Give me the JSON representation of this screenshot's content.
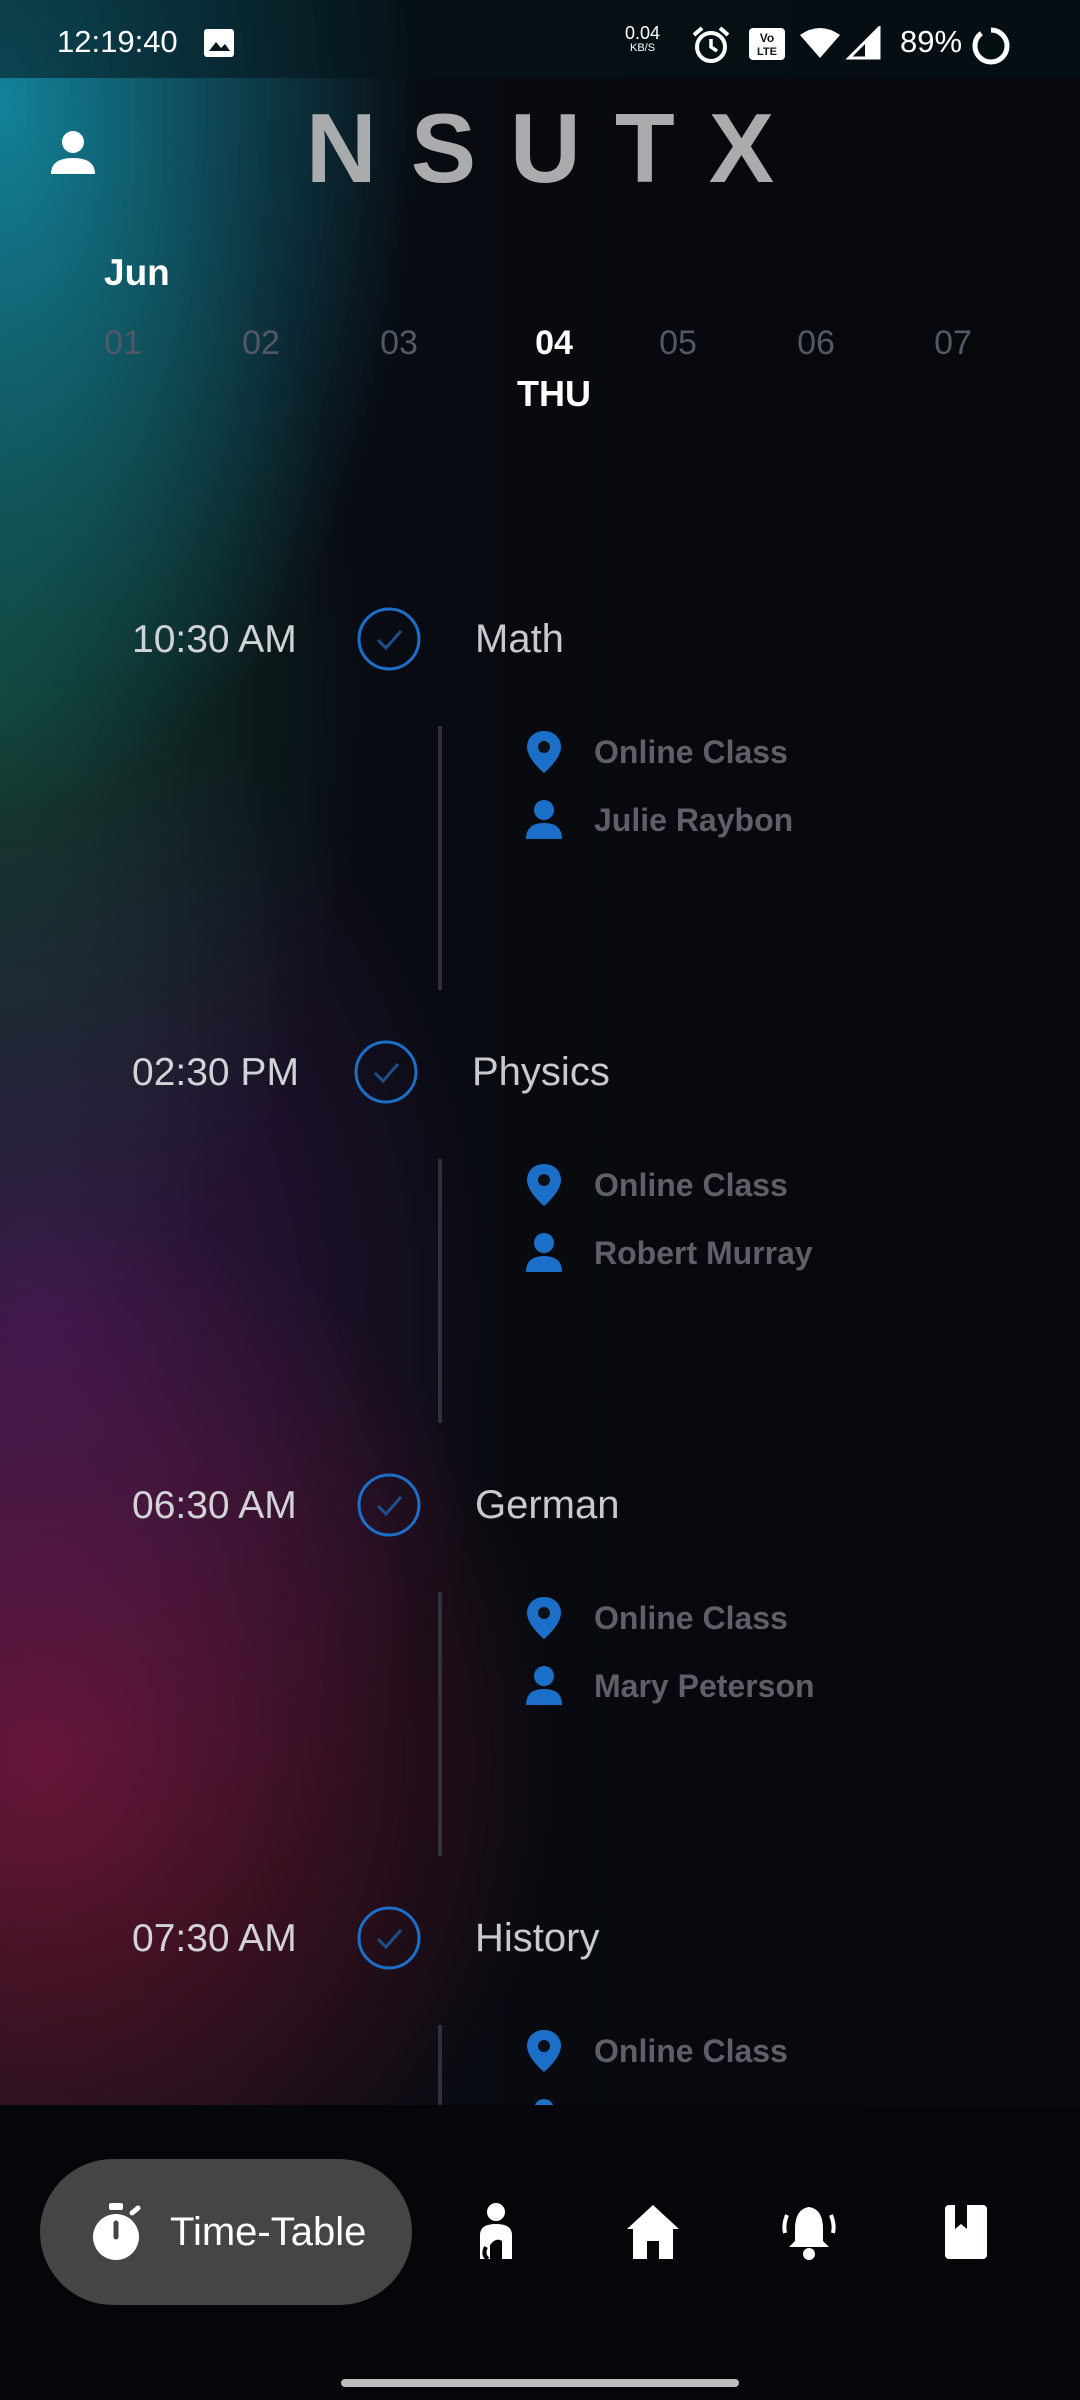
{
  "status_bar": {
    "time": "12:19:40",
    "net_speed": "0.04",
    "net_unit": "KB/S",
    "battery": "89%"
  },
  "header": {
    "title": "NSUTX"
  },
  "calendar": {
    "month": "Jun",
    "days": [
      {
        "num": "01",
        "dow": ""
      },
      {
        "num": "02",
        "dow": ""
      },
      {
        "num": "03",
        "dow": ""
      },
      {
        "num": "04",
        "dow": "THU",
        "selected": true
      },
      {
        "num": "05",
        "dow": ""
      },
      {
        "num": "06",
        "dow": ""
      },
      {
        "num": "07",
        "dow": ""
      }
    ]
  },
  "schedule": [
    {
      "time": "10:30 AM",
      "subject": "Math",
      "location": "Online Class",
      "teacher": "Julie Raybon"
    },
    {
      "time": "02:30 PM",
      "subject": "Physics",
      "location": "Online Class",
      "teacher": "Robert Murray"
    },
    {
      "time": "06:30 AM",
      "subject": "German",
      "location": "Online Class",
      "teacher": "Mary Peterson"
    },
    {
      "time": "07:30 AM",
      "subject": "History",
      "location": "Online Class",
      "teacher": ""
    }
  ],
  "bottom_nav": {
    "active_label": "Time-Table",
    "icons": [
      "stopwatch-icon",
      "person-icon",
      "home-icon",
      "bell-icon",
      "book-icon"
    ]
  },
  "colors": {
    "accent": "#1c6fc9",
    "pill": "#454545",
    "muted_text": "#5d6066"
  }
}
